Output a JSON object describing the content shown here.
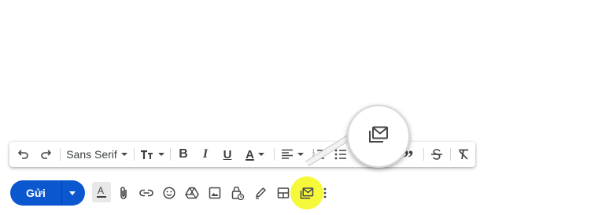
{
  "compose": {
    "send_label": "Gửi",
    "font_family_value": "Sans Serif"
  },
  "icons": {
    "undo": "undo-icon",
    "redo": "redo-icon",
    "text_size": "text-size-icon",
    "bold": "B",
    "italic": "I",
    "underline": "U",
    "text_color": "A",
    "align": "align-icon",
    "numbered_list": "numbered-list-icon",
    "bulleted_list": "bulleted-list-icon",
    "quote": "”",
    "strikethrough": "strikethrough-icon",
    "clear_formatting": "clear-formatting-icon",
    "formatting_toggle": "A",
    "attach": "paperclip-icon",
    "link": "link-icon",
    "emoji": "emoji-icon",
    "drive": "drive-icon",
    "photo": "photo-icon",
    "confidential": "lock-clock-icon",
    "signature": "pen-icon",
    "layouts": "layout-icon",
    "templates": "templates-mail-icon",
    "more": "more-vert-icon"
  },
  "colors": {
    "send_button": "#0b57d0",
    "highlight": "#f6f93a",
    "icon": "#444746"
  }
}
